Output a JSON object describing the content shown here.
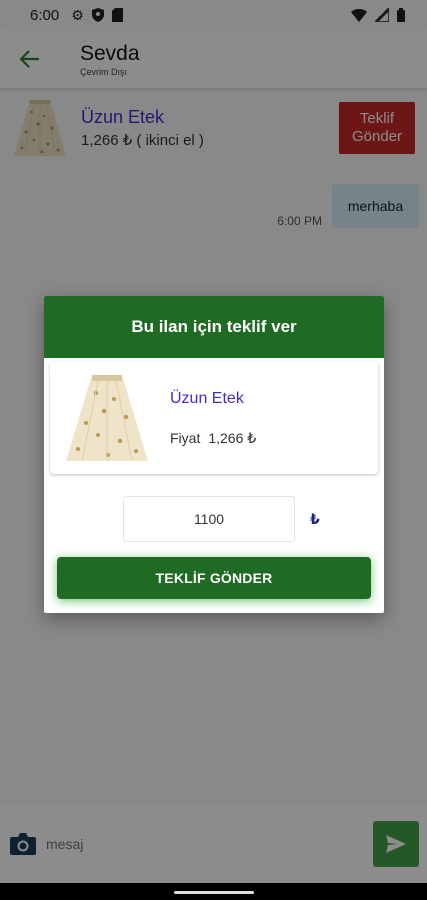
{
  "status_bar": {
    "time": "6:00",
    "icons_left": [
      "settings-icon",
      "shield-icon",
      "sim-card-icon"
    ],
    "icons_right": [
      "wifi-icon",
      "signal-icon",
      "battery-icon"
    ]
  },
  "app_bar": {
    "title": "Sevda",
    "subtitle": "Çevrim Dışı",
    "back_icon": "arrow-back-icon"
  },
  "listing": {
    "title": "Üzun Etek",
    "price_line": "1,266 ₺ ( ikinci el )",
    "offer_button": "Teklif\nGönder"
  },
  "messages": [
    {
      "text": "merhaba",
      "time": "6:00 PM"
    }
  ],
  "input_bar": {
    "placeholder": "mesaj",
    "camera_icon": "camera-icon",
    "send_icon": "send-icon"
  },
  "dialog": {
    "header": "Bu ilan için teklif ver",
    "product_title": "Üzun Etek",
    "price_label": "Fiyat",
    "price_value": "1,266 ₺",
    "amount_value": "1100",
    "currency": "₺",
    "submit_label": "TEKLİF GÖNDER"
  },
  "colors": {
    "primary_green": "#1f6b24",
    "accent_red": "#c62828",
    "link_purple": "#3f2fcc",
    "bubble_blue": "#d7eef8"
  }
}
